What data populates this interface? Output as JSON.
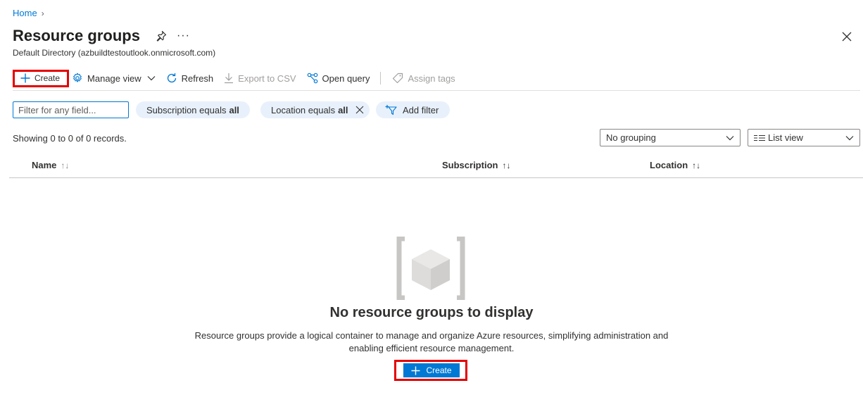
{
  "breadcrumb": {
    "home": "Home",
    "chevron": "›"
  },
  "header": {
    "title": "Resource groups",
    "subtitle": "Default Directory (azbuildtestoutlook.onmicrosoft.com)",
    "more": "···"
  },
  "toolbar": {
    "create": "Create",
    "manage_view": "Manage view",
    "refresh": "Refresh",
    "export_csv": "Export to CSV",
    "open_query": "Open query",
    "assign_tags": "Assign tags"
  },
  "filters": {
    "placeholder": "Filter for any field...",
    "subscription_prefix": "Subscription equals",
    "subscription_value": "all",
    "location_prefix": "Location equals",
    "location_value": "all",
    "add_filter": "Add filter"
  },
  "records_text": "Showing 0 to 0 of 0 records.",
  "grouping": {
    "selected": "No grouping"
  },
  "view": {
    "selected": "List view"
  },
  "table": {
    "columns": [
      {
        "label": "Name",
        "sort": "↑↓"
      },
      {
        "label": "Subscription",
        "sort": "↑↓"
      },
      {
        "label": "Location",
        "sort": "↑↓"
      }
    ],
    "rows": []
  },
  "empty_state": {
    "title": "No resource groups to display",
    "description_line1": "Resource groups provide a logical container to manage and organize Azure resources, simplifying administration and",
    "description_line2": "enabling efficient resource management.",
    "create_label": "Create"
  },
  "colors": {
    "accent": "#0078d4",
    "highlight_box": "#e50000",
    "pill_bg": "#e8f1fb"
  }
}
